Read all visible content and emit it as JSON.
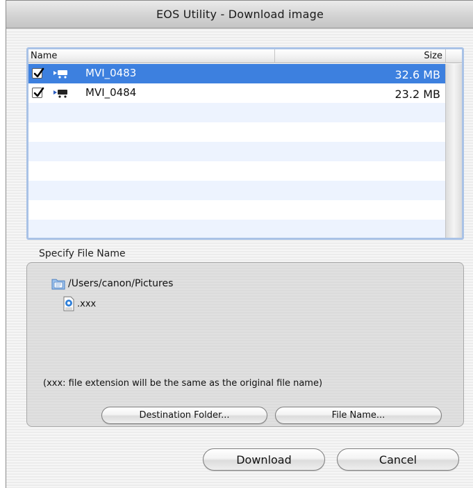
{
  "window": {
    "title": "EOS Utility - Download image"
  },
  "table": {
    "columns": {
      "name": "Name",
      "size": "Size"
    },
    "rows": [
      {
        "checked": true,
        "icon": "movie-icon",
        "name": "MVI_0483",
        "size": "32.6 MB",
        "selected": true
      },
      {
        "checked": true,
        "icon": "movie-icon",
        "name": "MVI_0484",
        "size": "23.2 MB",
        "selected": false
      }
    ]
  },
  "specify": {
    "label": "Specify File Name",
    "path": "/Users/canon/Pictures",
    "file": ".xxx",
    "note": "(xxx: file extension will be the same as the original file name)",
    "destination_button": "Destination Folder...",
    "filename_button": "File Name..."
  },
  "actions": {
    "download": "Download",
    "cancel": "Cancel"
  },
  "colors": {
    "selection": "#3d80df",
    "stripe": "#edf3fe",
    "focus_ring": "#a9c2e6"
  }
}
